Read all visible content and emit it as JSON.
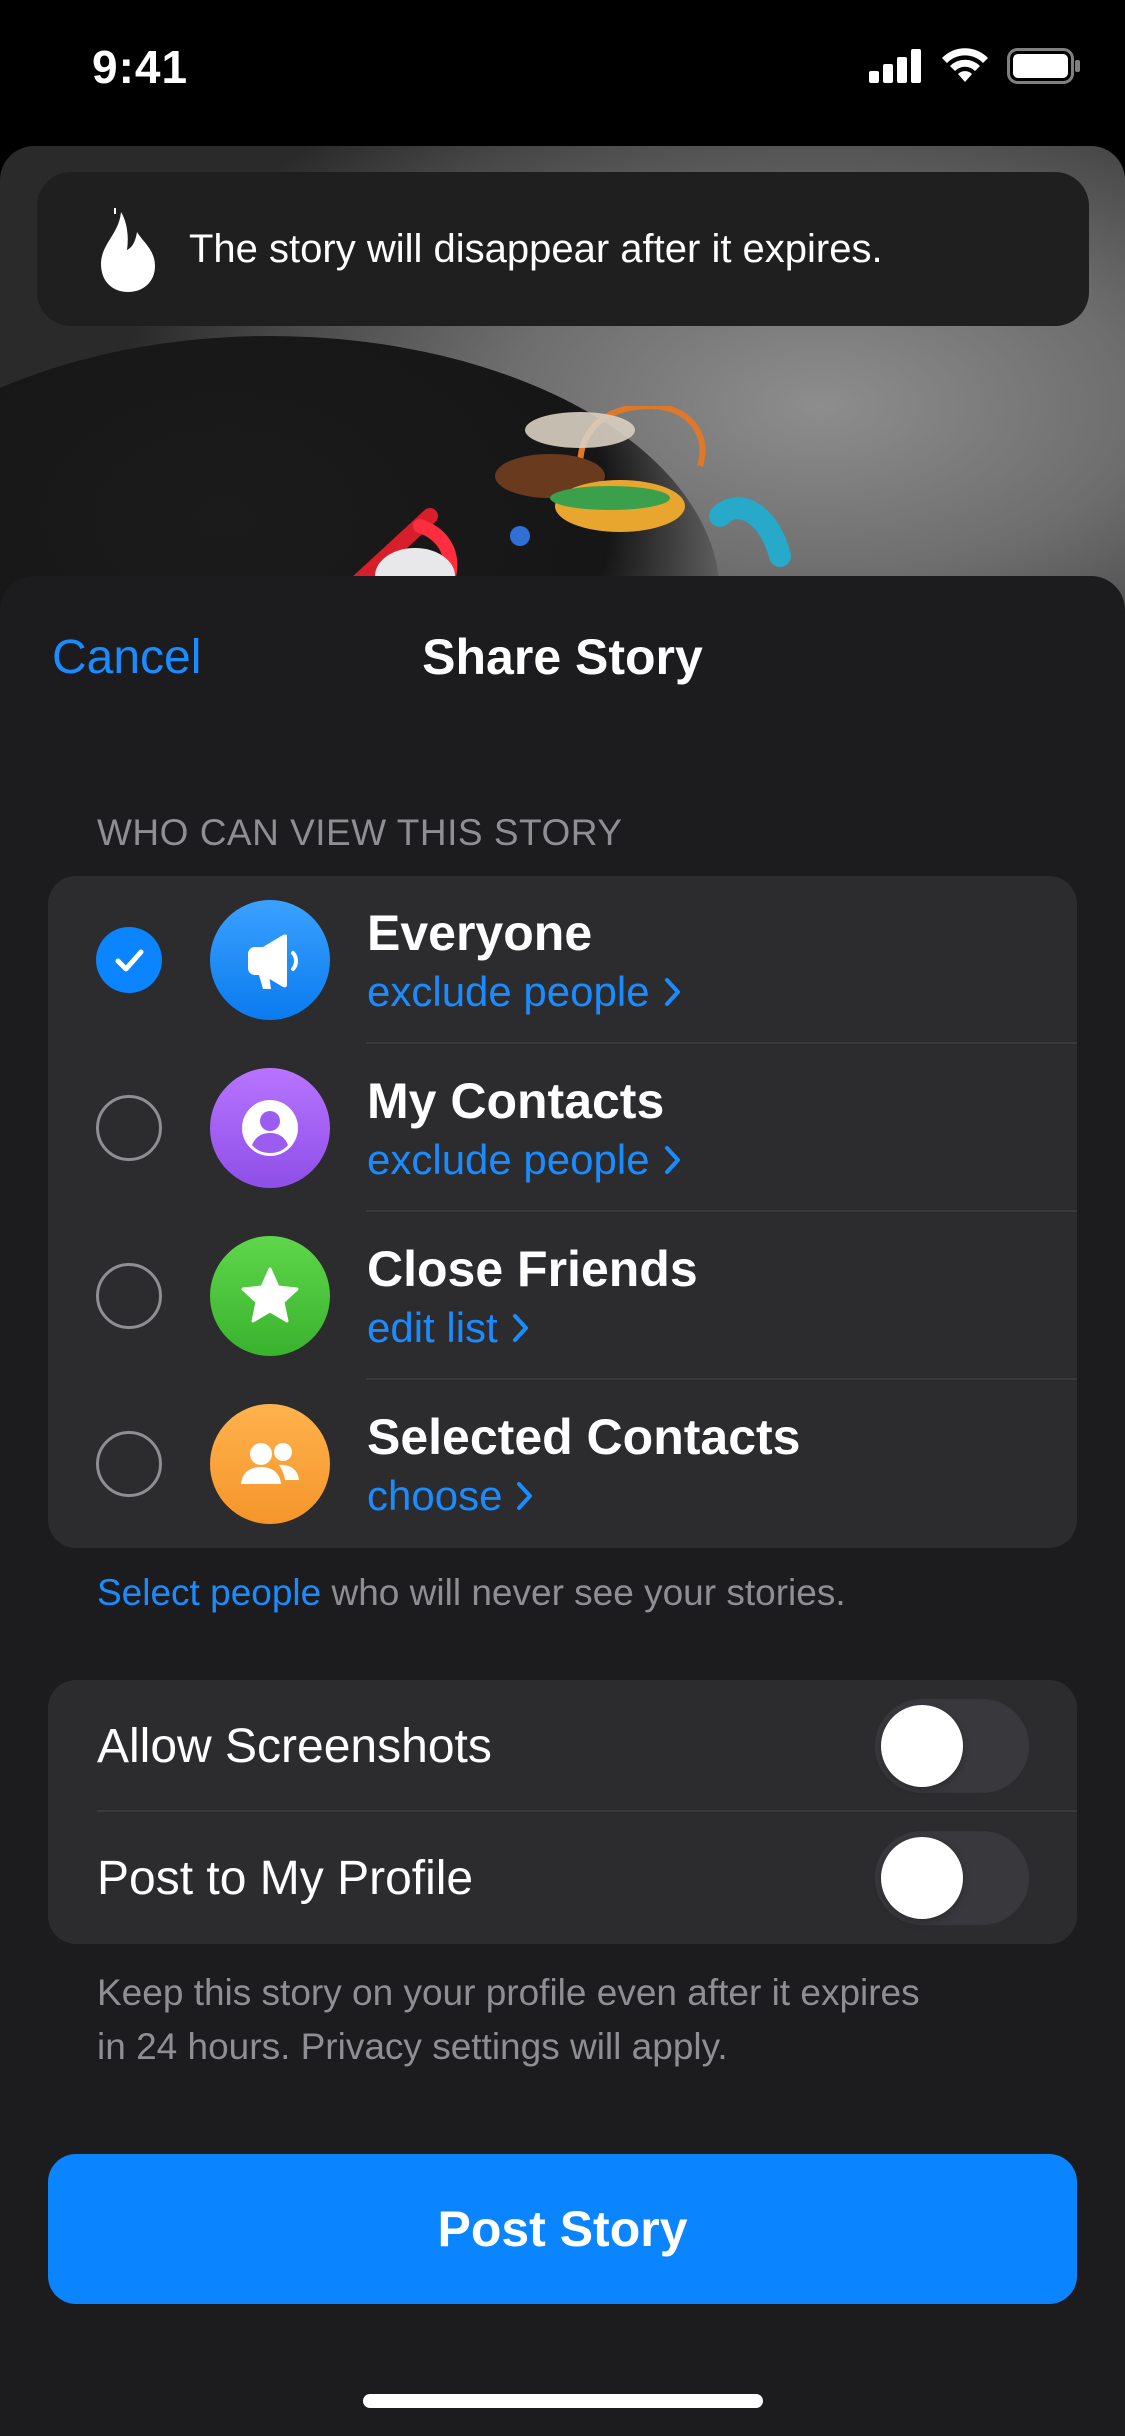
{
  "status_bar": {
    "time": "9:41",
    "icons": [
      "cellular-signal-icon",
      "wifi-icon",
      "battery-icon"
    ]
  },
  "toast": {
    "icon": "flame-icon",
    "text": "The story will disappear after it expires."
  },
  "sheet": {
    "cancel_label": "Cancel",
    "title": "Share Story",
    "audience_header": "WHO CAN VIEW THIS STORY",
    "audience_options": [
      {
        "title": "Everyone",
        "action": "exclude people",
        "icon": "megaphone-icon",
        "color": "#1d8bfe",
        "selected": true
      },
      {
        "title": "My Contacts",
        "action": "exclude people",
        "icon": "person-circle-icon",
        "color": "#9d5cf0",
        "selected": false
      },
      {
        "title": "Close Friends",
        "action": "edit list",
        "icon": "star-icon",
        "color": "#4cc43a",
        "selected": false
      },
      {
        "title": "Selected Contacts",
        "action": "choose",
        "icon": "people-icon",
        "color": "#f9a23a",
        "selected": false
      }
    ],
    "exclude_note": {
      "link": "Select people",
      "rest": " who will never see your stories."
    },
    "settings": [
      {
        "label": "Allow Screenshots",
        "on": false
      },
      {
        "label": "Post to My Profile",
        "on": false
      }
    ],
    "profile_note_line1": "Keep this story on your profile even after it expires",
    "profile_note_line2": "in 24 hours. Privacy settings will apply.",
    "post_button": "Post Story"
  },
  "colors": {
    "accent": "#0a84ff",
    "link": "#1a8cff",
    "sheet_bg": "#1c1c1e",
    "group_bg": "#2c2c2e"
  }
}
